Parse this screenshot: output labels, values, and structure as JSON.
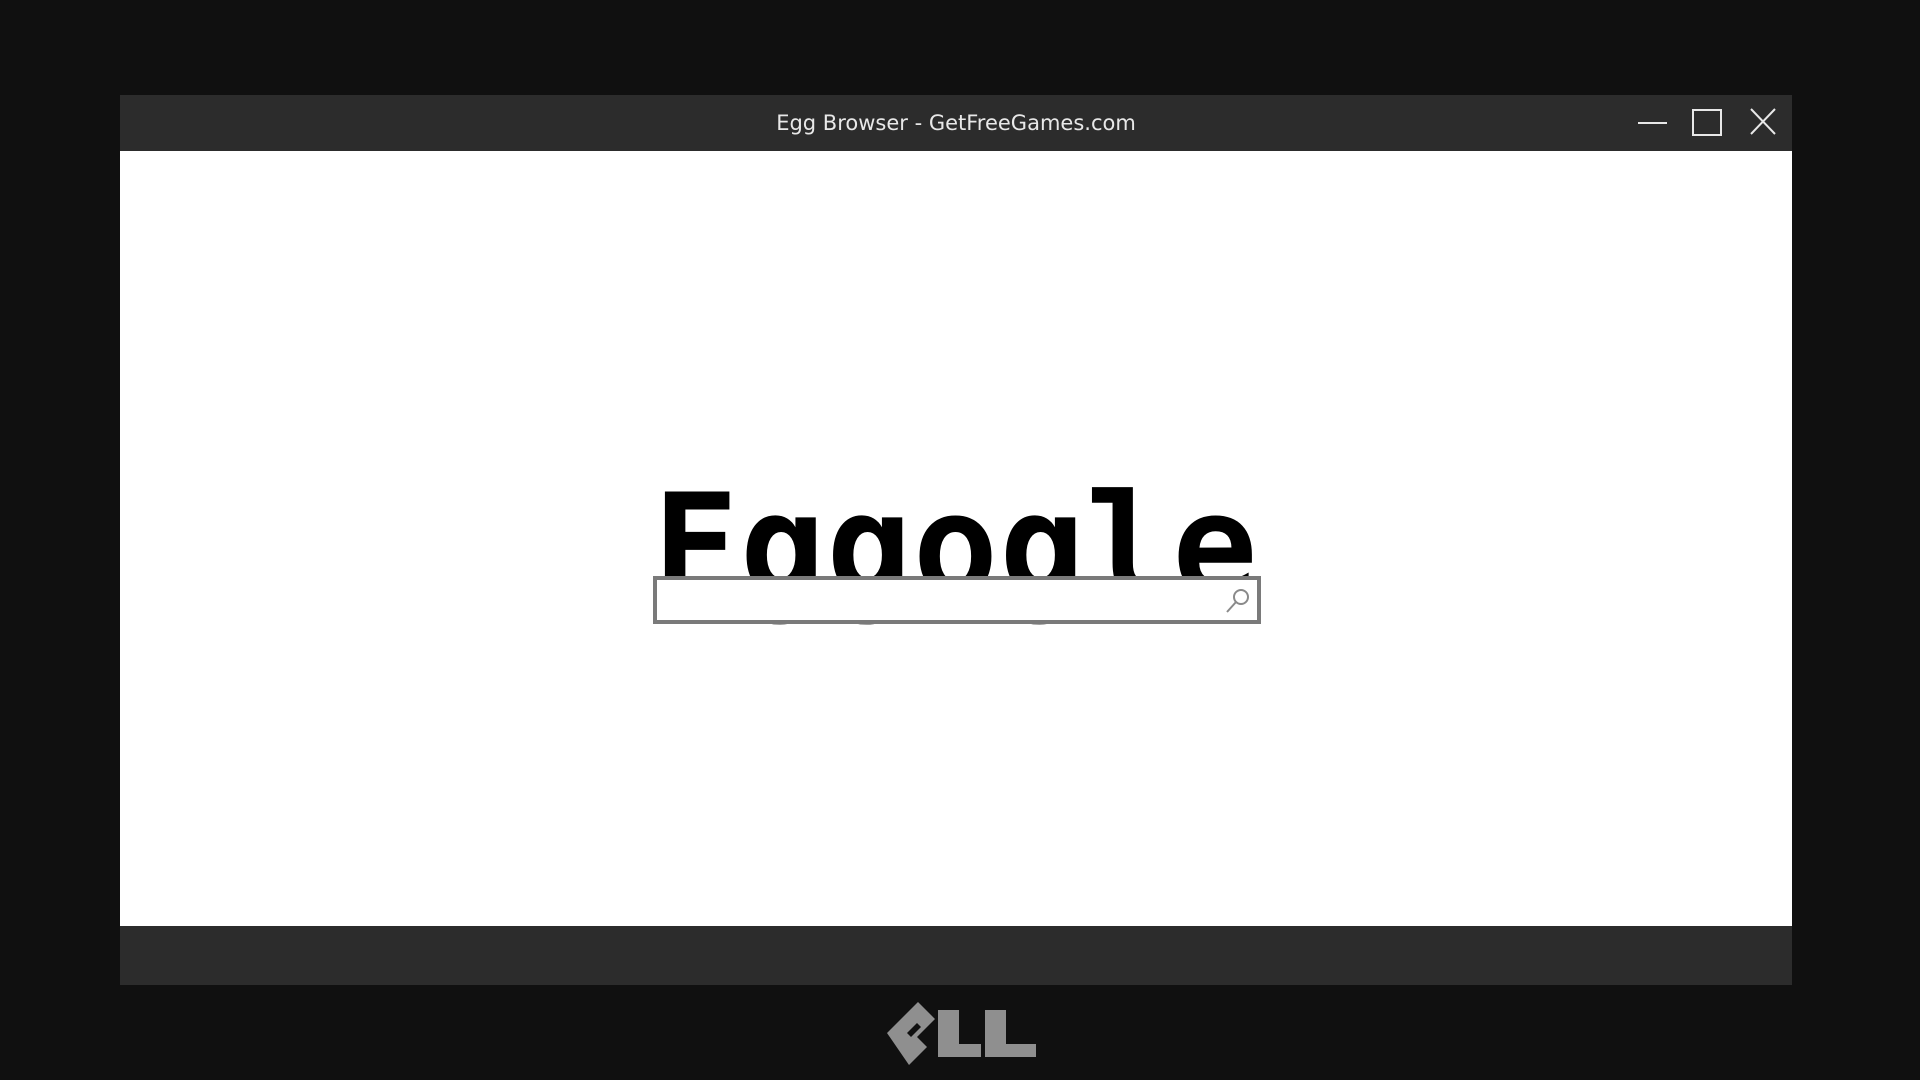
{
  "window": {
    "title": "Egg Browser - GetFreeGames.com",
    "controls": {
      "minimize_icon": "minimize-icon",
      "maximize_icon": "maximize-icon",
      "close_icon": "close-icon"
    }
  },
  "page": {
    "logo_text": "Eggogle",
    "search": {
      "value": "",
      "placeholder": "",
      "icon": "search-icon"
    }
  },
  "monitor": {
    "brand_logo": "ELL",
    "brand_icon": "monitor-brand-logo"
  },
  "colors": {
    "desktop_bg": "#101010",
    "chrome_bg": "#2c2c2c",
    "title_text": "#e8e8e8",
    "page_bg": "#ffffff",
    "logo_text": "#000000",
    "search_border": "#7a7a7a",
    "brand_logo": "#8f8f8f"
  }
}
